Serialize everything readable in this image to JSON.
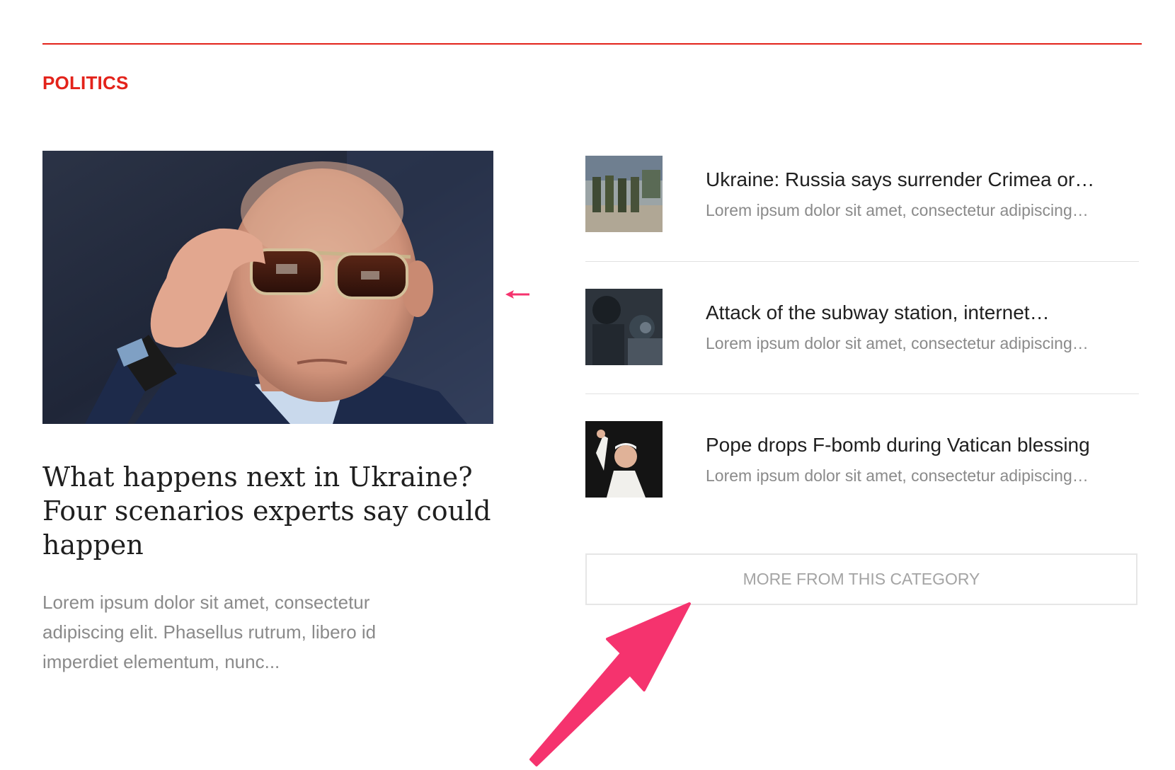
{
  "section": {
    "title": "POLITICS",
    "accent_color": "#e3231b"
  },
  "featured": {
    "image_alt": "man-with-sunglasses-photo",
    "title": "What happens next in Ukraine? Four scenarios experts say could happen",
    "excerpt": "Lorem ipsum dolor sit amet, consectetur adipiscing elit. Phasellus rutrum, libero id imperdiet elementum, nunc..."
  },
  "stories": [
    {
      "title": "Ukraine: Russia says surrender Crimea or…",
      "excerpt": "Lorem ipsum dolor sit amet, consectetur adipiscing…",
      "thumb": "soldiers-photo"
    },
    {
      "title": "Attack of the subway station, internet…",
      "excerpt": "Lorem ipsum dolor sit amet, consectetur adipiscing…",
      "thumb": "riot-police-photo"
    },
    {
      "title": "Pope drops F-bomb during Vatican blessing",
      "excerpt": "Lorem ipsum dolor sit amet, consectetur adipiscing…",
      "thumb": "pope-photo"
    }
  ],
  "more_button": {
    "label": "MORE FROM THIS CATEGORY"
  },
  "annotation": {
    "arrow_color": "#f5336e"
  }
}
